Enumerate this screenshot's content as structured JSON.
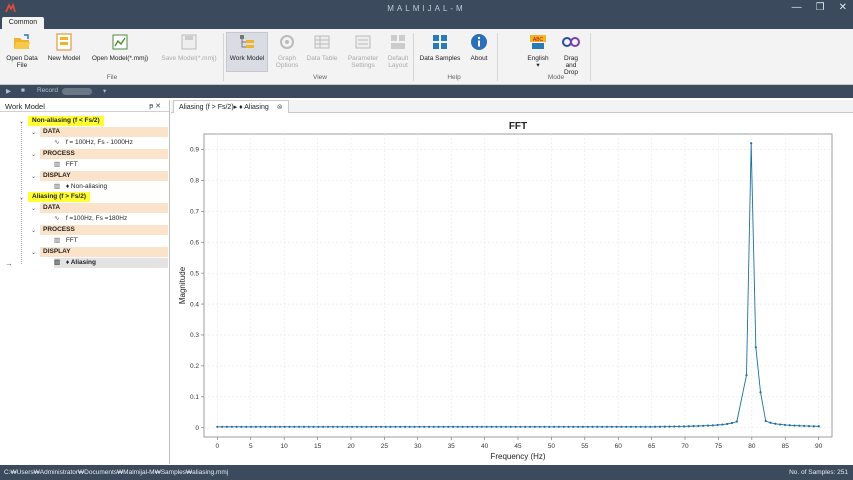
{
  "window": {
    "title": "MALMIJAL-M",
    "buttons": [
      "—",
      "❐",
      "✕"
    ]
  },
  "ribbon": {
    "active_tab": "Common",
    "buttons": [
      {
        "label": "Open Data File",
        "icon": "folder-open-icon",
        "enabled": true
      },
      {
        "label": "New Model",
        "icon": "new-model-icon",
        "enabled": true
      },
      {
        "label": "Open Model(*.mmj)",
        "icon": "open-model-icon",
        "enabled": true
      },
      {
        "label": "Save Model(*.mmj)",
        "icon": "save-model-icon",
        "enabled": false
      },
      {
        "label": "Work Model",
        "icon": "work-model-icon",
        "enabled": true
      },
      {
        "label": "Graph Options",
        "icon": "graph-options-icon",
        "enabled": false
      },
      {
        "label": "Data Table",
        "icon": "data-table-icon",
        "enabled": false
      },
      {
        "label": "Parameter Settings",
        "icon": "parameter-settings-icon",
        "enabled": false
      },
      {
        "label": "Default Layout",
        "icon": "default-layout-icon",
        "enabled": false
      },
      {
        "label": "Data Samples",
        "icon": "data-samples-icon",
        "enabled": true
      },
      {
        "label": "About",
        "icon": "info-icon",
        "enabled": true
      },
      {
        "label": "English",
        "icon": "language-icon",
        "enabled": true
      },
      {
        "label": "Drag and Drop",
        "icon": "drag-drop-icon",
        "enabled": true
      }
    ],
    "groups": [
      "File",
      "View",
      "Help",
      "Mode"
    ]
  },
  "recordbar": {
    "label": "Record",
    "play_icon": "▶",
    "stop_icon": "■",
    "menu_icon": "▾"
  },
  "work_model": {
    "title": "Work Model",
    "pin": "ᵽ  ✕",
    "tree": [
      {
        "kind": "model",
        "label": "Non-aliasing (f < Fs/2)"
      },
      {
        "kind": "stage",
        "label": "DATA"
      },
      {
        "kind": "leaf",
        "icon": "∿",
        "label": "f = 100Hz, Fs - 1000Hz"
      },
      {
        "kind": "stage",
        "label": "PROCESS"
      },
      {
        "kind": "leaf",
        "icon": "▥",
        "label": "FFT"
      },
      {
        "kind": "stage",
        "label": "DISPLAY"
      },
      {
        "kind": "leaf",
        "icon": "▥",
        "label": "♦ Non-aliasing"
      },
      {
        "kind": "model",
        "label": "Aliasing (f > Fs/2)"
      },
      {
        "kind": "stage",
        "label": "DATA"
      },
      {
        "kind": "leaf",
        "icon": "∿",
        "label": "f  =100Hz, Fs =180Hz"
      },
      {
        "kind": "stage",
        "label": "PROCESS"
      },
      {
        "kind": "leaf",
        "icon": "▥",
        "label": "FFT"
      },
      {
        "kind": "stage",
        "label": "DISPLAY"
      },
      {
        "kind": "leaf",
        "icon": "▥",
        "label": "♦ Aliasing",
        "selected": true
      }
    ]
  },
  "document_tab": {
    "label": "Aliasing (f > Fs/2)▸ ♦ Aliasing",
    "close": "⊗"
  },
  "chart_data": {
    "type": "line",
    "title": "FFT",
    "xlabel": "Frequency (Hz)",
    "ylabel": "Magnitude",
    "xlim": [
      -2,
      92
    ],
    "ylim": [
      -0.03,
      0.95
    ],
    "xticks": [
      0,
      5,
      10,
      15,
      20,
      25,
      30,
      35,
      40,
      45,
      50,
      55,
      60,
      65,
      70,
      75,
      80,
      85,
      90
    ],
    "yticks": [
      0,
      0.1,
      0.2,
      0.3,
      0.4,
      0.5,
      0.6,
      0.7,
      0.8,
      0.9
    ],
    "grid": true,
    "series_color": "#1f6f9f",
    "peak_frequency": 80,
    "peak_magnitude": 0.92,
    "x_step": 0.72,
    "x_start": 0,
    "x_end": 90,
    "points_highlighted": [
      {
        "x": 79.2,
        "y": 0.17
      },
      {
        "x": 79.9,
        "y": 0.92
      },
      {
        "x": 80.6,
        "y": 0.26
      },
      {
        "x": 81.3,
        "y": 0.115
      }
    ]
  },
  "status": {
    "path": "C:₩Users₩Administrator₩Documents₩Malmijal-M₩Samples₩aliasing.mmj",
    "samples": "No. of Samples: 251"
  }
}
